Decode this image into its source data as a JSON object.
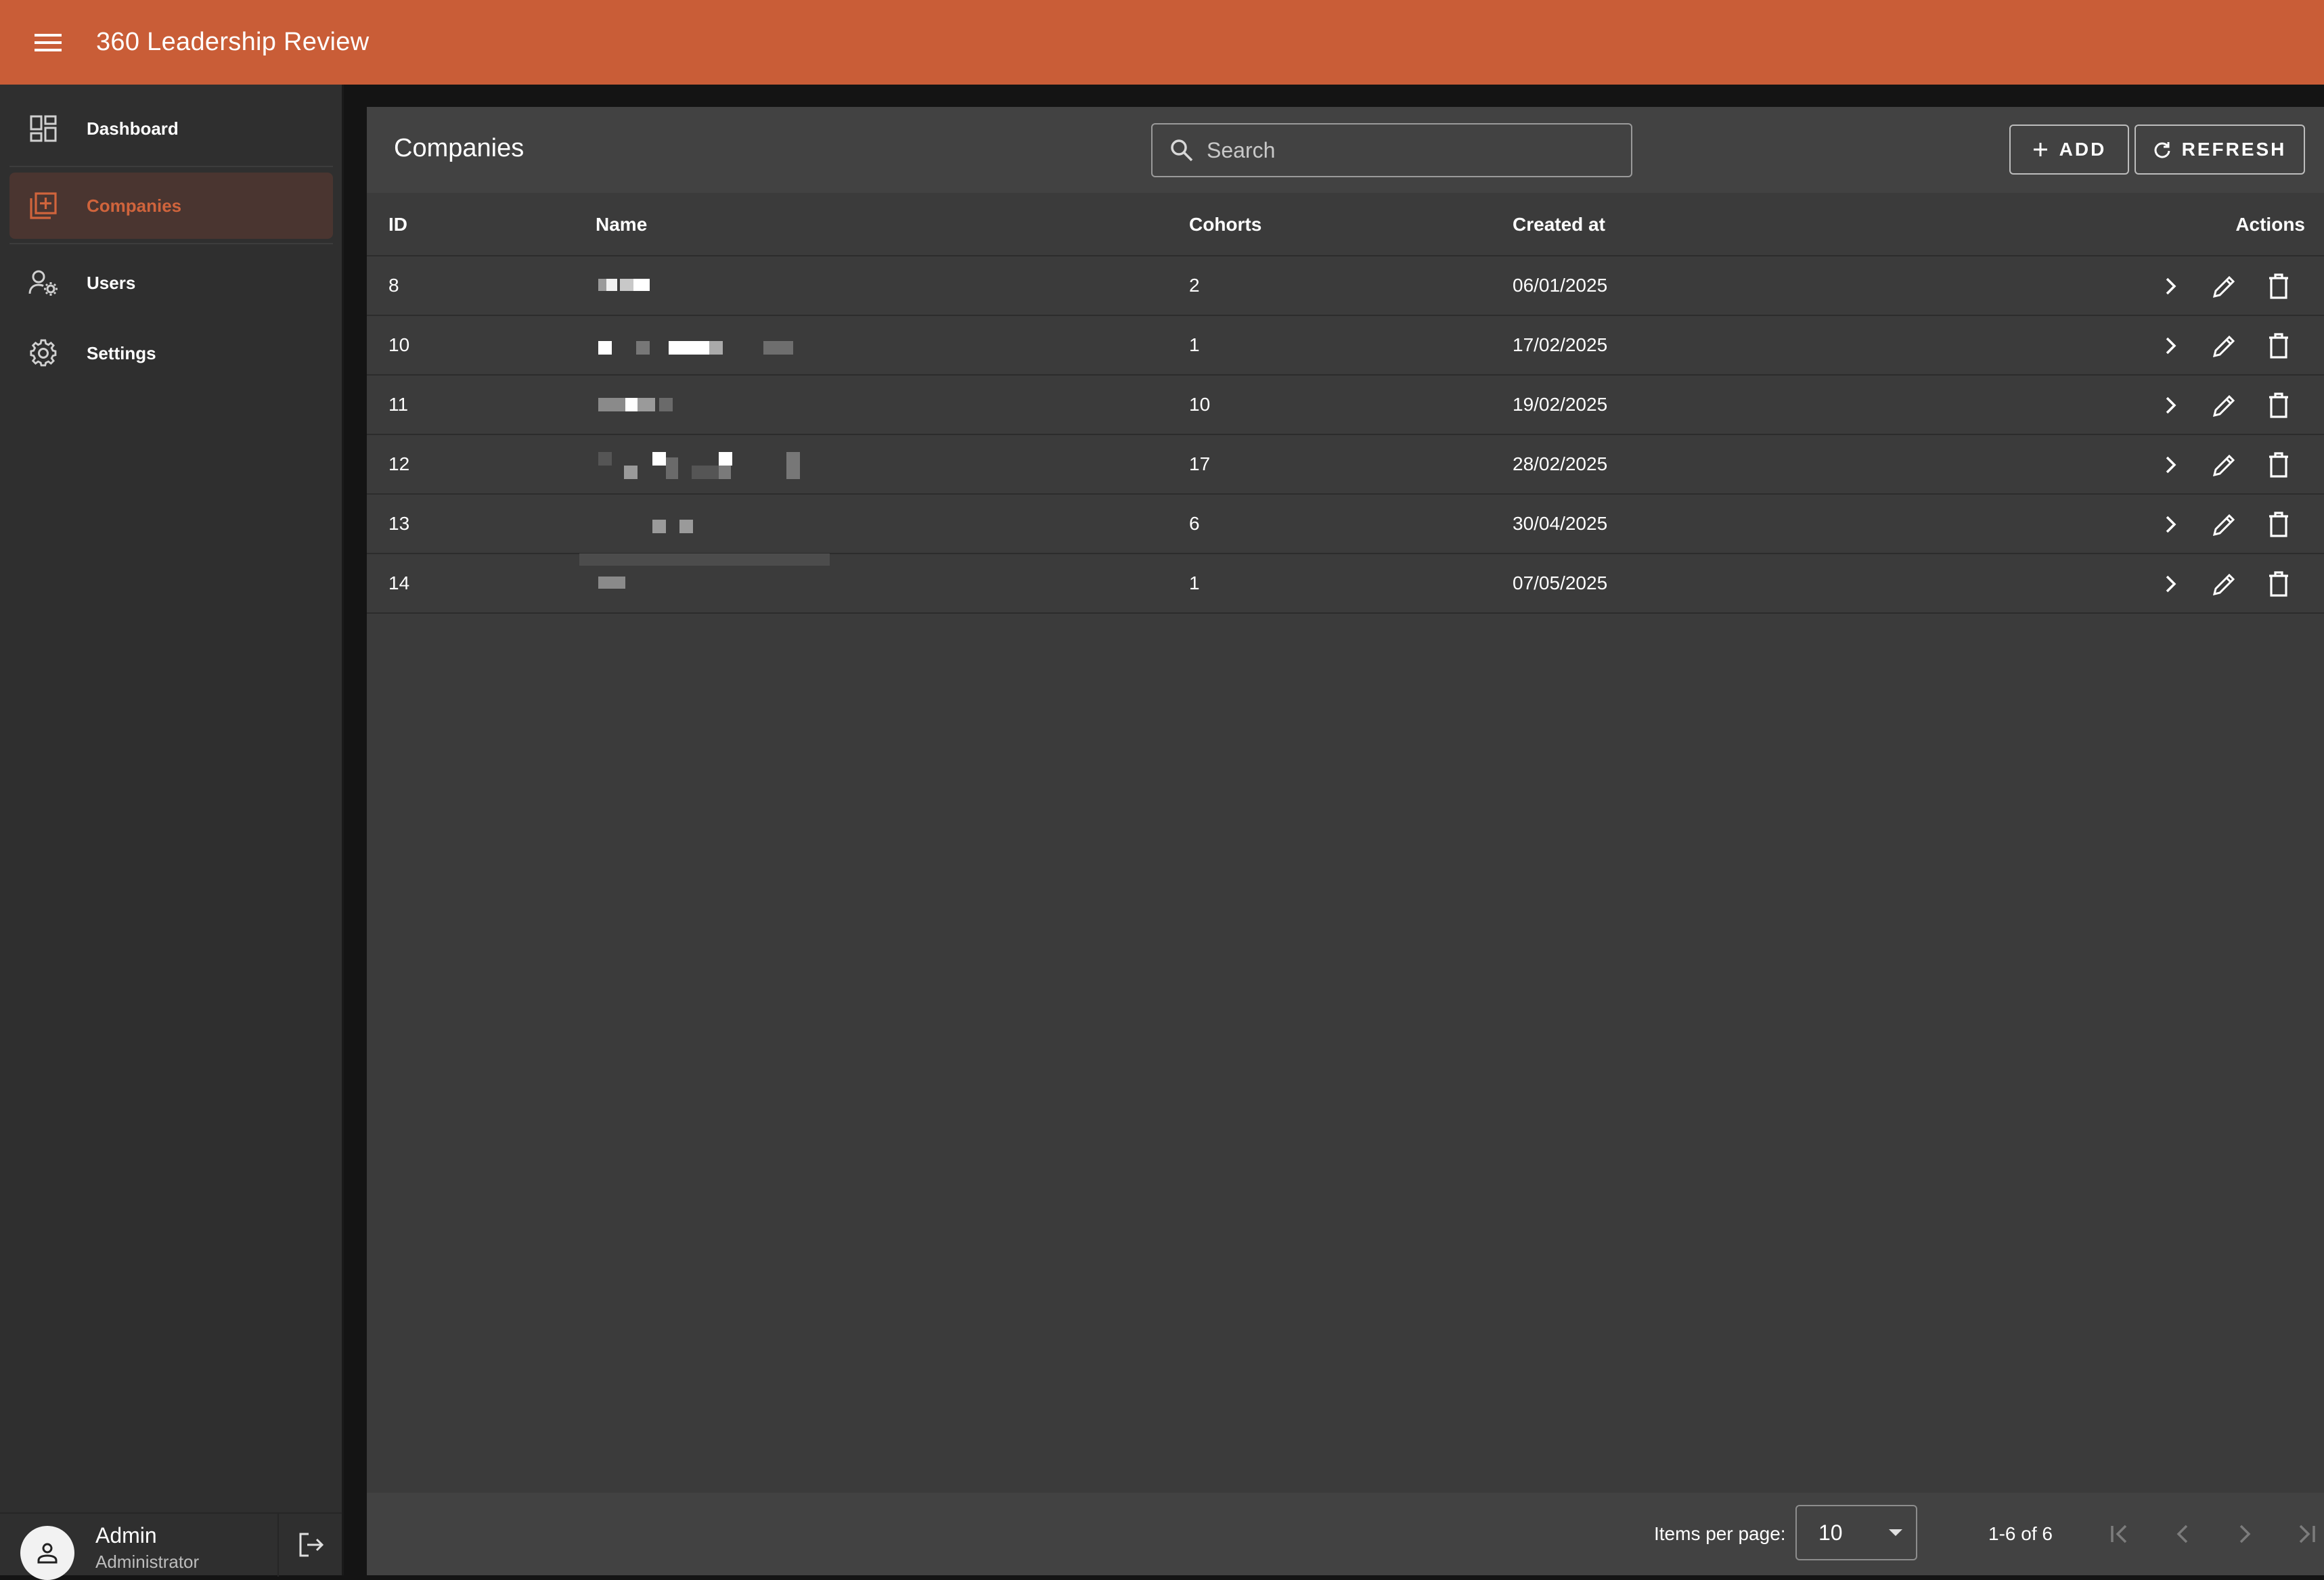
{
  "app": {
    "title": "360 Leadership Review"
  },
  "colors": {
    "brand": "#c95d37",
    "active_accent": "#d0643c",
    "surface": "#3b3b3b",
    "sidebar": "#2f2f2f"
  },
  "sidebar": {
    "items": [
      {
        "label": "Dashboard",
        "icon": "dashboard-icon",
        "active": false
      },
      {
        "label": "Companies",
        "icon": "library-add-icon",
        "active": true
      },
      {
        "label": "Users",
        "icon": "manage-accounts-icon",
        "active": false
      },
      {
        "label": "Settings",
        "icon": "gear-icon",
        "active": false
      }
    ],
    "user": {
      "name": "Admin",
      "role": "Administrator"
    }
  },
  "page": {
    "title": "Companies",
    "search": {
      "placeholder": "Search",
      "value": ""
    },
    "add_label": "ADD",
    "refresh_label": "REFRESH"
  },
  "table": {
    "columns": {
      "id": "ID",
      "name": "Name",
      "cohorts": "Cohorts",
      "created_at": "Created at",
      "actions": "Actions"
    },
    "rows": [
      {
        "id": "8",
        "cohorts": "2",
        "created_at": "06/01/2025"
      },
      {
        "id": "10",
        "cohorts": "1",
        "created_at": "17/02/2025"
      },
      {
        "id": "11",
        "cohorts": "10",
        "created_at": "19/02/2025"
      },
      {
        "id": "12",
        "cohorts": "17",
        "created_at": "28/02/2025"
      },
      {
        "id": "13",
        "cohorts": "6",
        "created_at": "30/04/2025"
      },
      {
        "id": "14",
        "cohorts": "1",
        "created_at": "07/05/2025"
      }
    ]
  },
  "paginator": {
    "items_per_page_label": "Items per page:",
    "items_per_page_value": "10",
    "range_label": "1-6 of 6"
  }
}
